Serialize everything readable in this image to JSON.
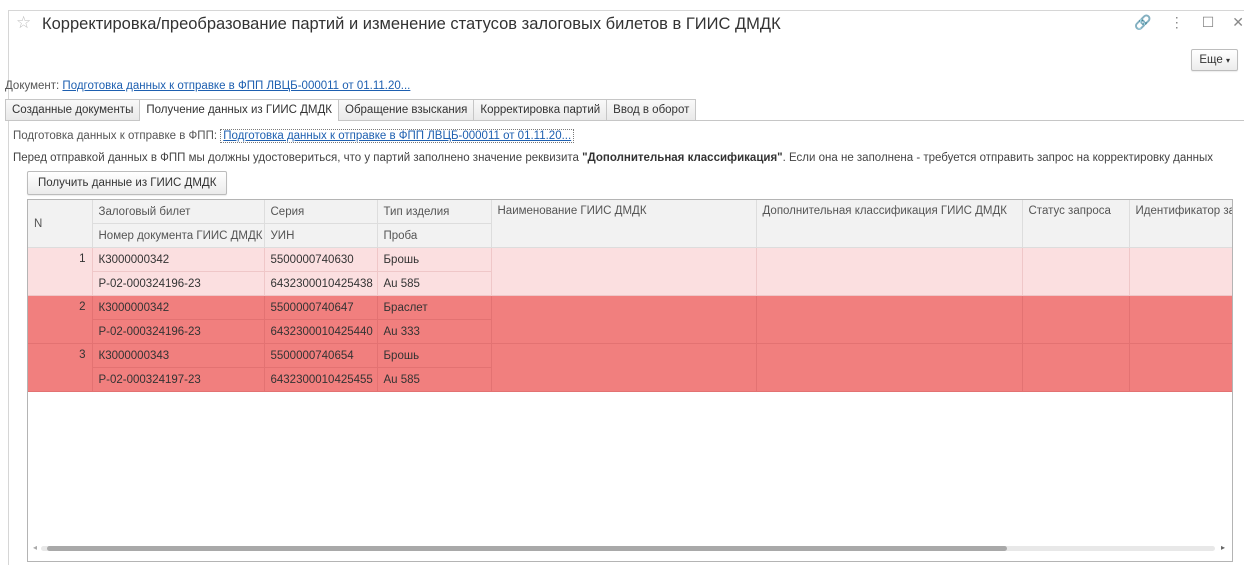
{
  "window": {
    "title": "Корректировка/преобразование партий и изменение статусов залоговых билетов в ГИИС ДМДК",
    "more_label": "Еще",
    "controls": {
      "link": "🔗",
      "menu": "⋮",
      "maximize": "☐",
      "close": "✕"
    }
  },
  "document": {
    "label": "Документ:",
    "link": "Подготовка данных к отправке в ФПП ЛВЦБ-000011 от 01.11.20..."
  },
  "tabs": [
    {
      "label": "Созданные документы"
    },
    {
      "label": "Получение данных из ГИИС ДМДК"
    },
    {
      "label": "Обращение взыскания"
    },
    {
      "label": "Корректировка партий"
    },
    {
      "label": "Ввод в оборот"
    }
  ],
  "panel": {
    "prep_label": "Подготовка данных к отправке в ФПП:",
    "prep_link": "Подготовка данных к отправке в ФПП ЛВЦБ-000011 от 01.11.20...",
    "note_before": "Перед отправкой данных в ФПП мы должны удостовериться, что у партий заполнено значение реквизита ",
    "note_bold": "\"Дополнительная классификация\"",
    "note_after": ". Если она не заполнена - требуется отправить запрос на корректировку данных",
    "get_button": "Получить данные из ГИИС ДМДК"
  },
  "table": {
    "headers": {
      "n": "N",
      "ticket": "Залоговый билет",
      "series": "Серия",
      "type": "Тип изделия",
      "name": "Наименование ГИИС ДМДК",
      "extra": "Дополнительная классификация ГИИС ДМДК",
      "status": "Статус запроса",
      "ident": "Идентификатор за",
      "docnum": "Номер документа ГИИС ДМДК",
      "uin": "УИН",
      "probe": "Проба"
    },
    "rows": [
      {
        "n": "1",
        "ticket": "К3000000342",
        "series": "5500000740630",
        "type": "Брошь",
        "docnum": "Р-02-000324196-23",
        "uin": "6432300010425438",
        "probe": "Au 585"
      },
      {
        "n": "2",
        "ticket": "К3000000342",
        "series": "5500000740647",
        "type": "Браслет",
        "docnum": "Р-02-000324196-23",
        "uin": "6432300010425440",
        "probe": "Au 333"
      },
      {
        "n": "3",
        "ticket": "К3000000343",
        "series": "5500000740654",
        "type": "Брошь",
        "docnum": "Р-02-000324197-23",
        "uin": "6432300010425455",
        "probe": "Au 585"
      }
    ]
  },
  "colors": {
    "row_selected": "#fbdfe0",
    "row_error": "#f17f7e",
    "link": "#1d5fb0"
  }
}
